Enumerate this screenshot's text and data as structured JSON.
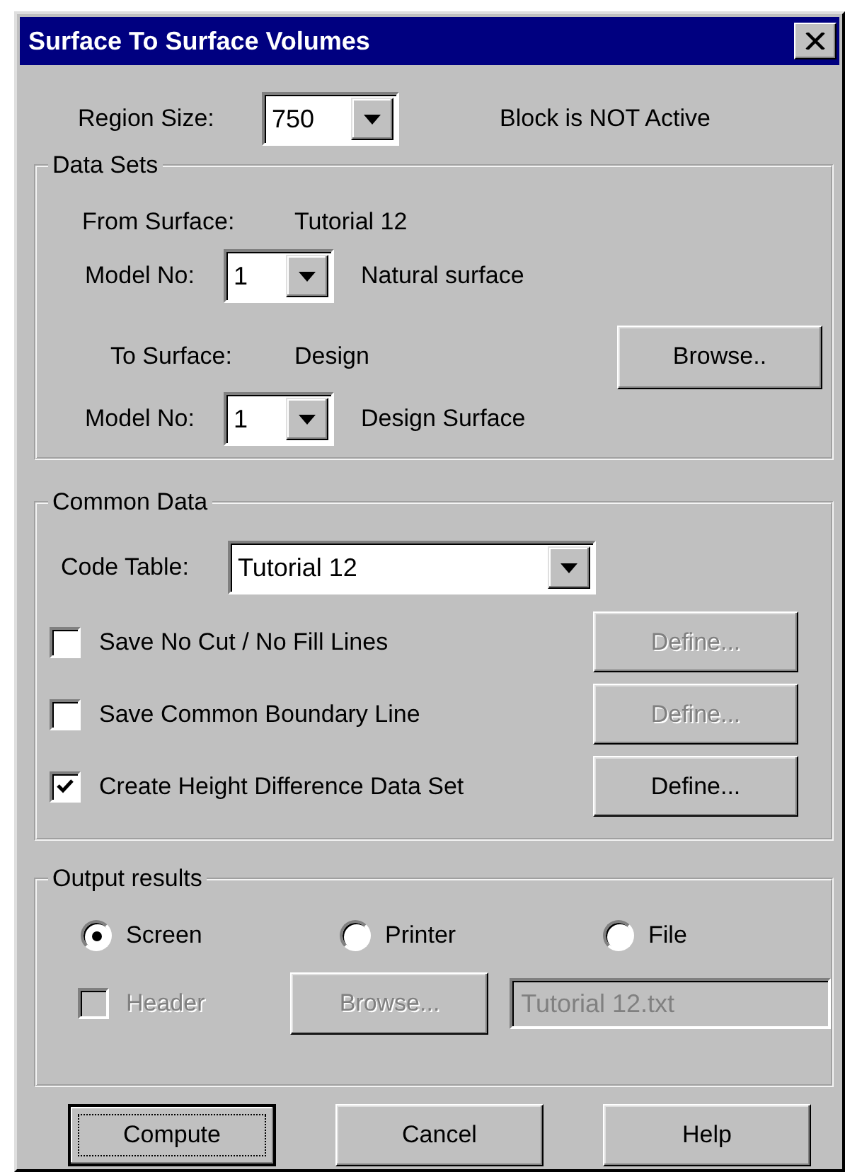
{
  "window": {
    "title": "Surface To Surface Volumes"
  },
  "region": {
    "label": "Region Size:",
    "value": "750",
    "status": "Block is NOT Active"
  },
  "data_sets": {
    "title": "Data Sets",
    "from_surface": {
      "label": "From Surface:",
      "value": "Tutorial 12"
    },
    "from_model": {
      "label": "Model No:",
      "value": "1",
      "description": "Natural surface"
    },
    "to_surface": {
      "label": "To Surface:",
      "value": "Design"
    },
    "browse": {
      "label": "Browse..",
      "disabled": false
    },
    "to_model": {
      "label": "Model No:",
      "value": "1",
      "description": "Design Surface"
    }
  },
  "common_data": {
    "title": "Common Data",
    "code_table": {
      "label": "Code Table:",
      "value": "Tutorial 12"
    },
    "options": [
      {
        "label": "Save No Cut / No Fill Lines",
        "checked": false,
        "button": {
          "label": "Define...",
          "disabled": true
        }
      },
      {
        "label": "Save Common Boundary Line",
        "checked": false,
        "button": {
          "label": "Define...",
          "disabled": true
        }
      },
      {
        "label": "Create Height Difference Data Set",
        "checked": true,
        "button": {
          "label": "Define...",
          "disabled": false
        }
      }
    ]
  },
  "output": {
    "title": "Output results",
    "destinations": [
      {
        "label": "Screen",
        "selected": true
      },
      {
        "label": "Printer",
        "selected": false
      },
      {
        "label": "File",
        "selected": false
      }
    ],
    "header": {
      "label": "Header",
      "checked": false,
      "disabled": true
    },
    "browse": {
      "label": "Browse...",
      "disabled": true
    },
    "file_field": {
      "value": "Tutorial 12.txt",
      "disabled": true
    }
  },
  "buttons": [
    {
      "label": "Compute",
      "focused": true
    },
    {
      "label": "Cancel",
      "focused": false
    },
    {
      "label": "Help",
      "focused": false
    }
  ]
}
